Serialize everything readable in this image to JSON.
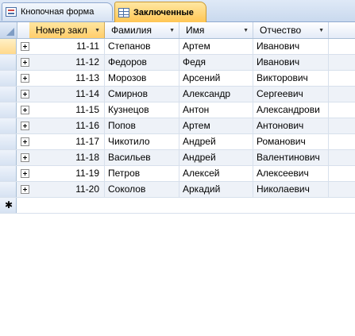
{
  "tabs": [
    {
      "label": "Кнопочная форма",
      "icon": "form-icon",
      "active": false
    },
    {
      "label": "Заключенные",
      "icon": "table-icon",
      "active": true
    }
  ],
  "columns": [
    {
      "label": "Номер закл",
      "sort_icon": "chevron-down-icon"
    },
    {
      "label": "Фамилия",
      "sort_icon": "chevron-down-icon"
    },
    {
      "label": "Имя",
      "sort_icon": "chevron-down-icon"
    },
    {
      "label": "Отчество",
      "sort_icon": "chevron-down-icon"
    }
  ],
  "rows": [
    {
      "id": "11-11",
      "last": "Степанов",
      "first": "Артем",
      "middle": "Иванович"
    },
    {
      "id": "11-12",
      "last": "Федоров",
      "first": "Федя",
      "middle": "Иванович"
    },
    {
      "id": "11-13",
      "last": "Морозов",
      "first": "Арсений",
      "middle": "Викторович"
    },
    {
      "id": "11-14",
      "last": "Смирнов",
      "first": "Александр",
      "middle": "Сергеевич"
    },
    {
      "id": "11-15",
      "last": "Кузнецов",
      "first": "Антон",
      "middle": "Александрови"
    },
    {
      "id": "11-16",
      "last": "Попов",
      "first": "Артем",
      "middle": "Антонович"
    },
    {
      "id": "11-17",
      "last": "Чикотило",
      "first": "Андрей",
      "middle": "Романович"
    },
    {
      "id": "11-18",
      "last": "Васильев",
      "first": "Андрей",
      "middle": "Валентинович"
    },
    {
      "id": "11-19",
      "last": "Петров",
      "first": "Алексей",
      "middle": "Алексеевич"
    },
    {
      "id": "11-20",
      "last": "Соколов",
      "first": "Аркадий",
      "middle": "Николаевич"
    }
  ],
  "new_row_marker": "✱",
  "colors": {
    "accent": "#ffc654",
    "header": "#e3ebf7",
    "alt_row": "#eef2f8"
  }
}
